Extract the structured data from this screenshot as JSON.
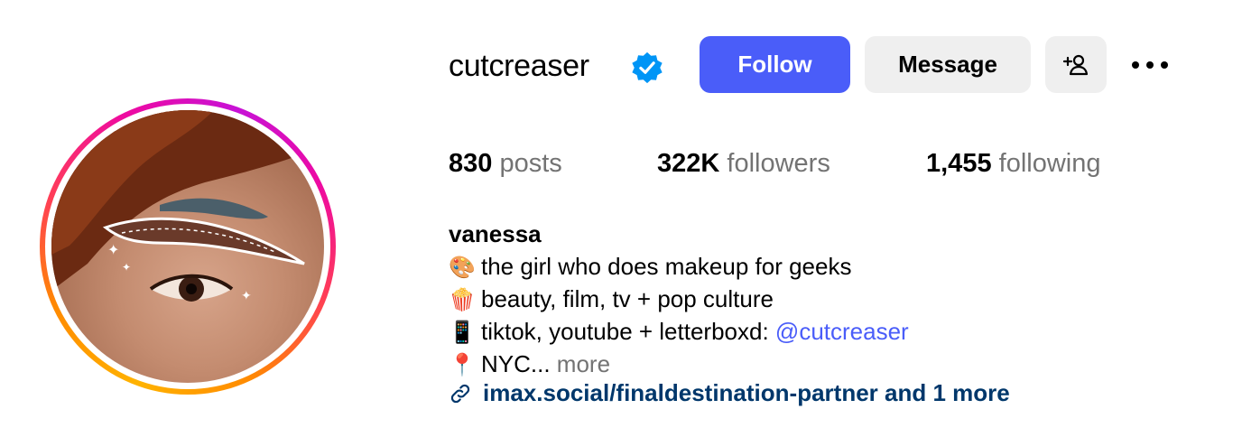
{
  "profile": {
    "username": "cutcreaser",
    "verified": true,
    "icons": {
      "verified": "verified-badge-icon",
      "add_user": "add-user-icon",
      "more": "more-options-icon",
      "link": "link-icon"
    },
    "colors": {
      "follow_button": "#4a5df9",
      "secondary_button": "#efefef",
      "link": "#00376b",
      "mention": "#4a5df9",
      "muted": "#737373",
      "verified": "#0095f6"
    }
  },
  "actions": {
    "follow_label": "Follow",
    "message_label": "Message"
  },
  "stats": {
    "posts": {
      "count": "830",
      "label": "posts"
    },
    "followers": {
      "count": "322K",
      "label": "followers"
    },
    "following": {
      "count": "1,455",
      "label": "following"
    }
  },
  "bio": {
    "name": "vanessa",
    "lines": [
      {
        "emoji": "🎨",
        "text": "the girl who does makeup for geeks"
      },
      {
        "emoji": "🍿",
        "text": "beauty, film, tv + pop culture"
      },
      {
        "emoji": "📱",
        "text": "tiktok, youtube + letterboxd: ",
        "mention": "@cutcreaser"
      },
      {
        "emoji": "📍",
        "text": "NYC... ",
        "more": "more"
      }
    ],
    "link_text": "imax.social/finaldestination-partner and 1 more"
  }
}
